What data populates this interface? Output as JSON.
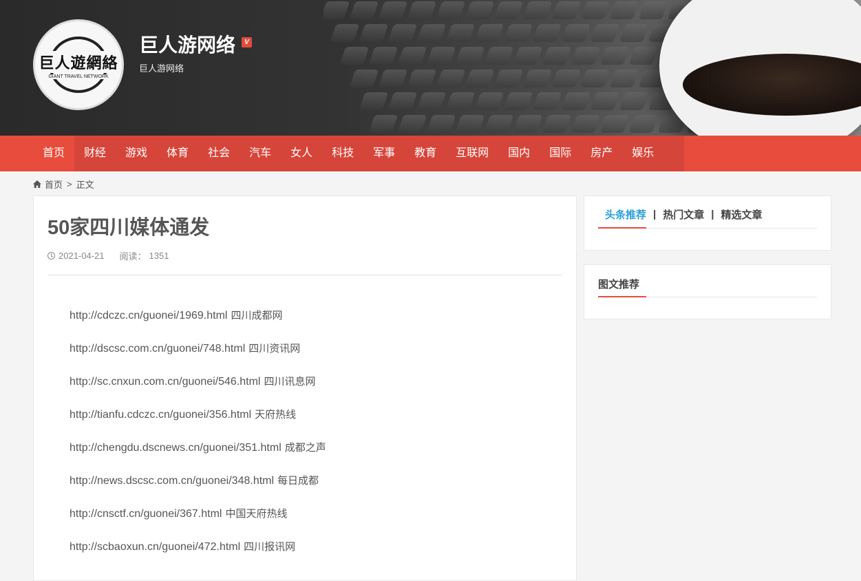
{
  "header": {
    "logo_text": "巨人遊網絡",
    "logo_subtext": "GIANT TRAVEL NETWORK",
    "site_title": "巨人游网络",
    "verified_badge": "V",
    "site_subtitle": "巨人游网络"
  },
  "nav": {
    "items": [
      "首页",
      "财经",
      "游戏",
      "体育",
      "社会",
      "汽车",
      "女人",
      "科技",
      "军事",
      "教育",
      "互联网",
      "国内",
      "国际",
      "房产",
      "娱乐"
    ]
  },
  "breadcrumb": {
    "home": "首页",
    "separator": ">",
    "current": "正文"
  },
  "article": {
    "title": "50家四川媒体通发",
    "date": "2021-04-21",
    "reads_label": "阅读：",
    "reads_count": "1351",
    "links": [
      {
        "url": "http://cdczc.cn/guonei/1969.html",
        "site": "四川成都网"
      },
      {
        "url": "http://dscsc.com.cn/guonei/748.html",
        "site": "四川资讯网"
      },
      {
        "url": "http://sc.cnxun.com.cn/guonei/546.html",
        "site": "四川讯息网"
      },
      {
        "url": "http://tianfu.cdczc.cn/guonei/356.html",
        "site": "天府热线"
      },
      {
        "url": "http://chengdu.dscnews.cn/guonei/351.html",
        "site": "成都之声"
      },
      {
        "url": "http://news.dscsc.com.cn/guonei/348.html",
        "site": "每日成都"
      },
      {
        "url": "http://cnsctf.cn/guonei/367.html",
        "site": "中国天府热线"
      },
      {
        "url": "http://scbaoxun.cn/guonei/472.html",
        "site": "四川报讯网"
      }
    ]
  },
  "sidebar": {
    "tabs": [
      "头条推荐",
      "热门文章",
      "精选文章"
    ],
    "tab_separator": "|",
    "box2_title": "图文推荐"
  },
  "colors": {
    "nav_red": "#e74c3c",
    "nav_red_dark": "#d5453a",
    "accent_blue": "#2aa0d8"
  }
}
